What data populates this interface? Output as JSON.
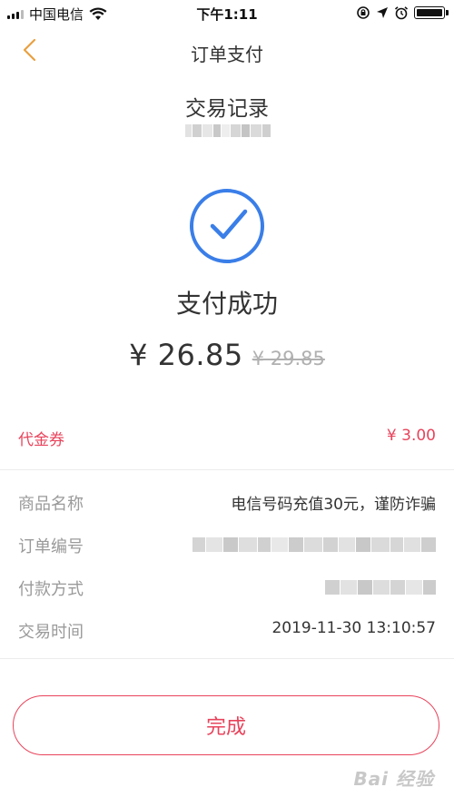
{
  "status_bar": {
    "carrier": "中国电信",
    "time": "下午1:11",
    "icons": [
      "signal-icon",
      "wifi-icon",
      "lock-rotation-icon",
      "location-arrow-icon",
      "alarm-icon",
      "battery-icon"
    ]
  },
  "nav": {
    "title": "订单支付",
    "back_icon": "chevron-left-icon"
  },
  "merchant": {
    "name": "交易记录"
  },
  "result": {
    "icon": "check-circle-icon",
    "status": "支付成功",
    "amount": "¥ 26.85",
    "original_amount": "¥ 29.85"
  },
  "coupon": {
    "label": "代金券",
    "value": "¥ 3.00"
  },
  "details": {
    "product_label": "商品名称",
    "product_value": "电信号码充值30元，谨防诈骗",
    "order_label": "订单编号",
    "payment_label": "付款方式",
    "time_label": "交易时间",
    "time_value": "2019-11-30 13:10:57"
  },
  "button": {
    "done_label": "完成"
  },
  "watermark": {
    "text": "Bai 经验"
  },
  "colors": {
    "accent": "#e8435b",
    "success_blue": "#3a7ee8",
    "back_orange": "#e8a040",
    "label_gray": "#9a9a9a"
  }
}
